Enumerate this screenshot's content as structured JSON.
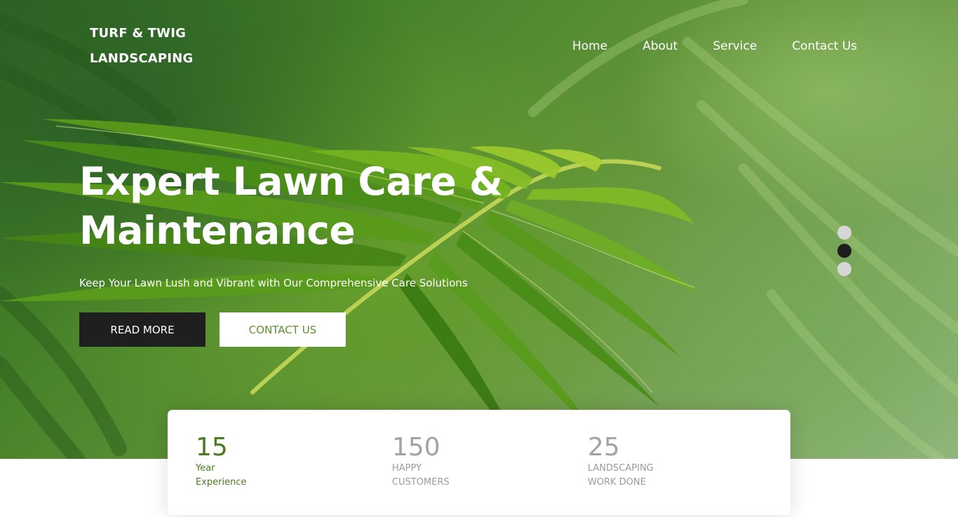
{
  "brand": {
    "line1": "TURF & TWIG",
    "line2": "LANDSCAPING"
  },
  "nav": {
    "items": [
      "Home",
      "About",
      "Service",
      "Contact Us"
    ]
  },
  "hero": {
    "title_line1": "Expert Lawn Care &",
    "title_line2": "Maintenance",
    "subtitle": "Keep Your Lawn Lush and Vibrant with Our Comprehensive Care Solutions",
    "read_more_label": "READ MORE",
    "contact_label": "CONTACT US",
    "background_icon": "fern-leaf-photo"
  },
  "carousel": {
    "slide_count": 3,
    "active_index": 1
  },
  "stats": [
    {
      "value": "15",
      "label_line1": "Year",
      "label_line2": "Experience"
    },
    {
      "value": "150",
      "label_line1": "HAPPY",
      "label_line2": "CUSTOMERS"
    },
    {
      "value": "25",
      "label_line1": "LANDSCAPING",
      "label_line2": "WORK DONE"
    }
  ],
  "colors": {
    "accent_green": "#4c7a22",
    "button_dark": "#1f1f1f",
    "contact_text": "#5c8f2e",
    "muted_gray": "#a3a3a3"
  }
}
